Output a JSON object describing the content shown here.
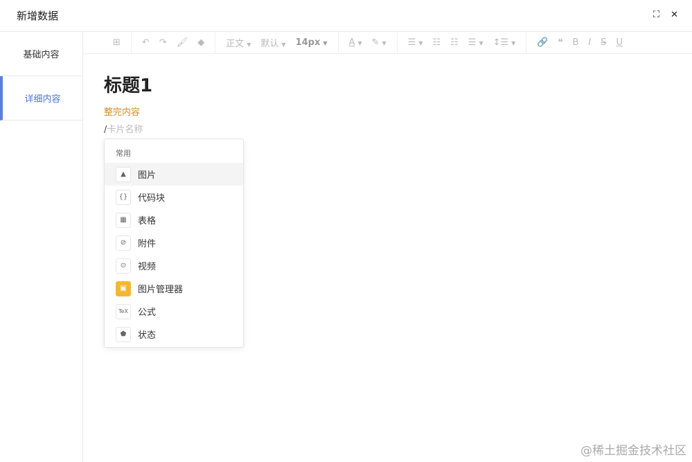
{
  "header": {
    "title": "新增数据"
  },
  "sidebar": {
    "tabs": [
      {
        "label": "基础内容"
      },
      {
        "label": "详细内容"
      }
    ]
  },
  "toolbar": {
    "paragraph": "正文",
    "font": "默认",
    "size": "14px"
  },
  "editor": {
    "heading": "标题1",
    "highlight_text": "整完内容",
    "slash": "/",
    "placeholder": "卡片名称"
  },
  "menu": {
    "section": "常用",
    "items": [
      {
        "label": "图片",
        "icon": "image-icon"
      },
      {
        "label": "代码块",
        "icon": "code-block-icon"
      },
      {
        "label": "表格",
        "icon": "table-icon"
      },
      {
        "label": "附件",
        "icon": "attachment-icon"
      },
      {
        "label": "视频",
        "icon": "video-icon"
      },
      {
        "label": "图片管理器",
        "icon": "image-manager-icon"
      },
      {
        "label": "公式",
        "icon": "formula-icon"
      },
      {
        "label": "状态",
        "icon": "status-icon"
      }
    ]
  },
  "watermark": "@稀土掘金技术社区"
}
